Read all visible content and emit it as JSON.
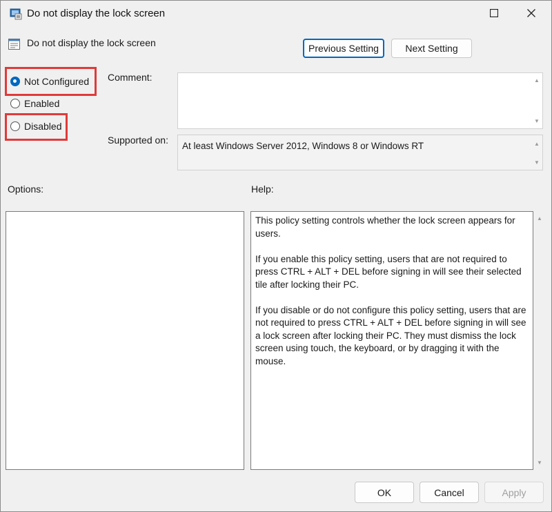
{
  "window": {
    "title": "Do not display the lock screen",
    "setting_name": "Do not display the lock screen"
  },
  "nav": {
    "previous_label": "Previous Setting",
    "next_label": "Next Setting"
  },
  "state": {
    "options": [
      {
        "label": "Not Configured",
        "selected": true,
        "highlighted": true
      },
      {
        "label": "Enabled",
        "selected": false,
        "highlighted": false
      },
      {
        "label": "Disabled",
        "selected": false,
        "highlighted": true
      }
    ]
  },
  "comment": {
    "label": "Comment:",
    "value": ""
  },
  "supported": {
    "label": "Supported on:",
    "value": "At least Windows Server 2012, Windows 8 or Windows RT"
  },
  "options_section": {
    "label": "Options:"
  },
  "help_section": {
    "label": "Help:",
    "paragraphs": [
      "This policy setting controls whether the lock screen appears for users.",
      "If you enable this policy setting, users that are not required to press CTRL + ALT + DEL before signing in will see their selected tile after locking their PC.",
      "If you disable or do not configure this policy setting, users that are not required to press CTRL + ALT + DEL before signing in will see a lock screen after locking their PC. They must dismiss the lock screen using touch, the keyboard, or by dragging it with the mouse."
    ]
  },
  "footer": {
    "ok_label": "OK",
    "cancel_label": "Cancel",
    "apply_label": "Apply"
  },
  "colors": {
    "accent": "#0067c0",
    "highlight": "#e03a3a",
    "window_bg": "#f0f0f0"
  },
  "icons": {
    "title": "group-policy-icon",
    "setting": "policy-setting-icon",
    "maximize": "maximize-icon",
    "close": "close-icon"
  }
}
